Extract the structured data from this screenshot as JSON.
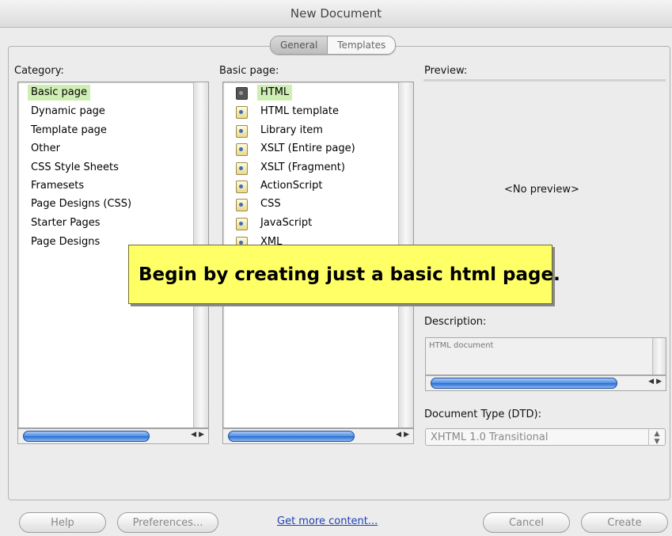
{
  "window": {
    "title": "New Document"
  },
  "tabs": [
    "General",
    "Templates"
  ],
  "category": {
    "label": "Category:",
    "items": [
      "Basic page",
      "Dynamic page",
      "Template page",
      "Other",
      "CSS Style Sheets",
      "Framesets",
      "Page Designs (CSS)",
      "Starter Pages",
      "Page Designs"
    ],
    "selected": "Basic page"
  },
  "basic_page": {
    "label": "Basic page:",
    "items": [
      "HTML",
      "HTML template",
      "Library item",
      "XSLT (Entire page)",
      "XSLT (Fragment)",
      "ActionScript",
      "CSS",
      "JavaScript",
      "XML"
    ],
    "selected": "HTML"
  },
  "preview": {
    "label": "Preview:",
    "text": "<No preview>"
  },
  "description": {
    "label": "Description:",
    "text": "HTML document"
  },
  "doctype": {
    "label": "Document Type (DTD):",
    "value": "XHTML 1.0 Transitional"
  },
  "footer": {
    "help": "Help",
    "preferences": "Preferences...",
    "get_more": "Get more content...",
    "cancel": "Cancel",
    "create": "Create"
  },
  "callout": {
    "text": "Begin by creating just a basic html page."
  },
  "colors": {
    "selection": "#cfeeb3",
    "callout_bg": "#ffff66",
    "scroll_thumb": "#4d8ee6"
  }
}
